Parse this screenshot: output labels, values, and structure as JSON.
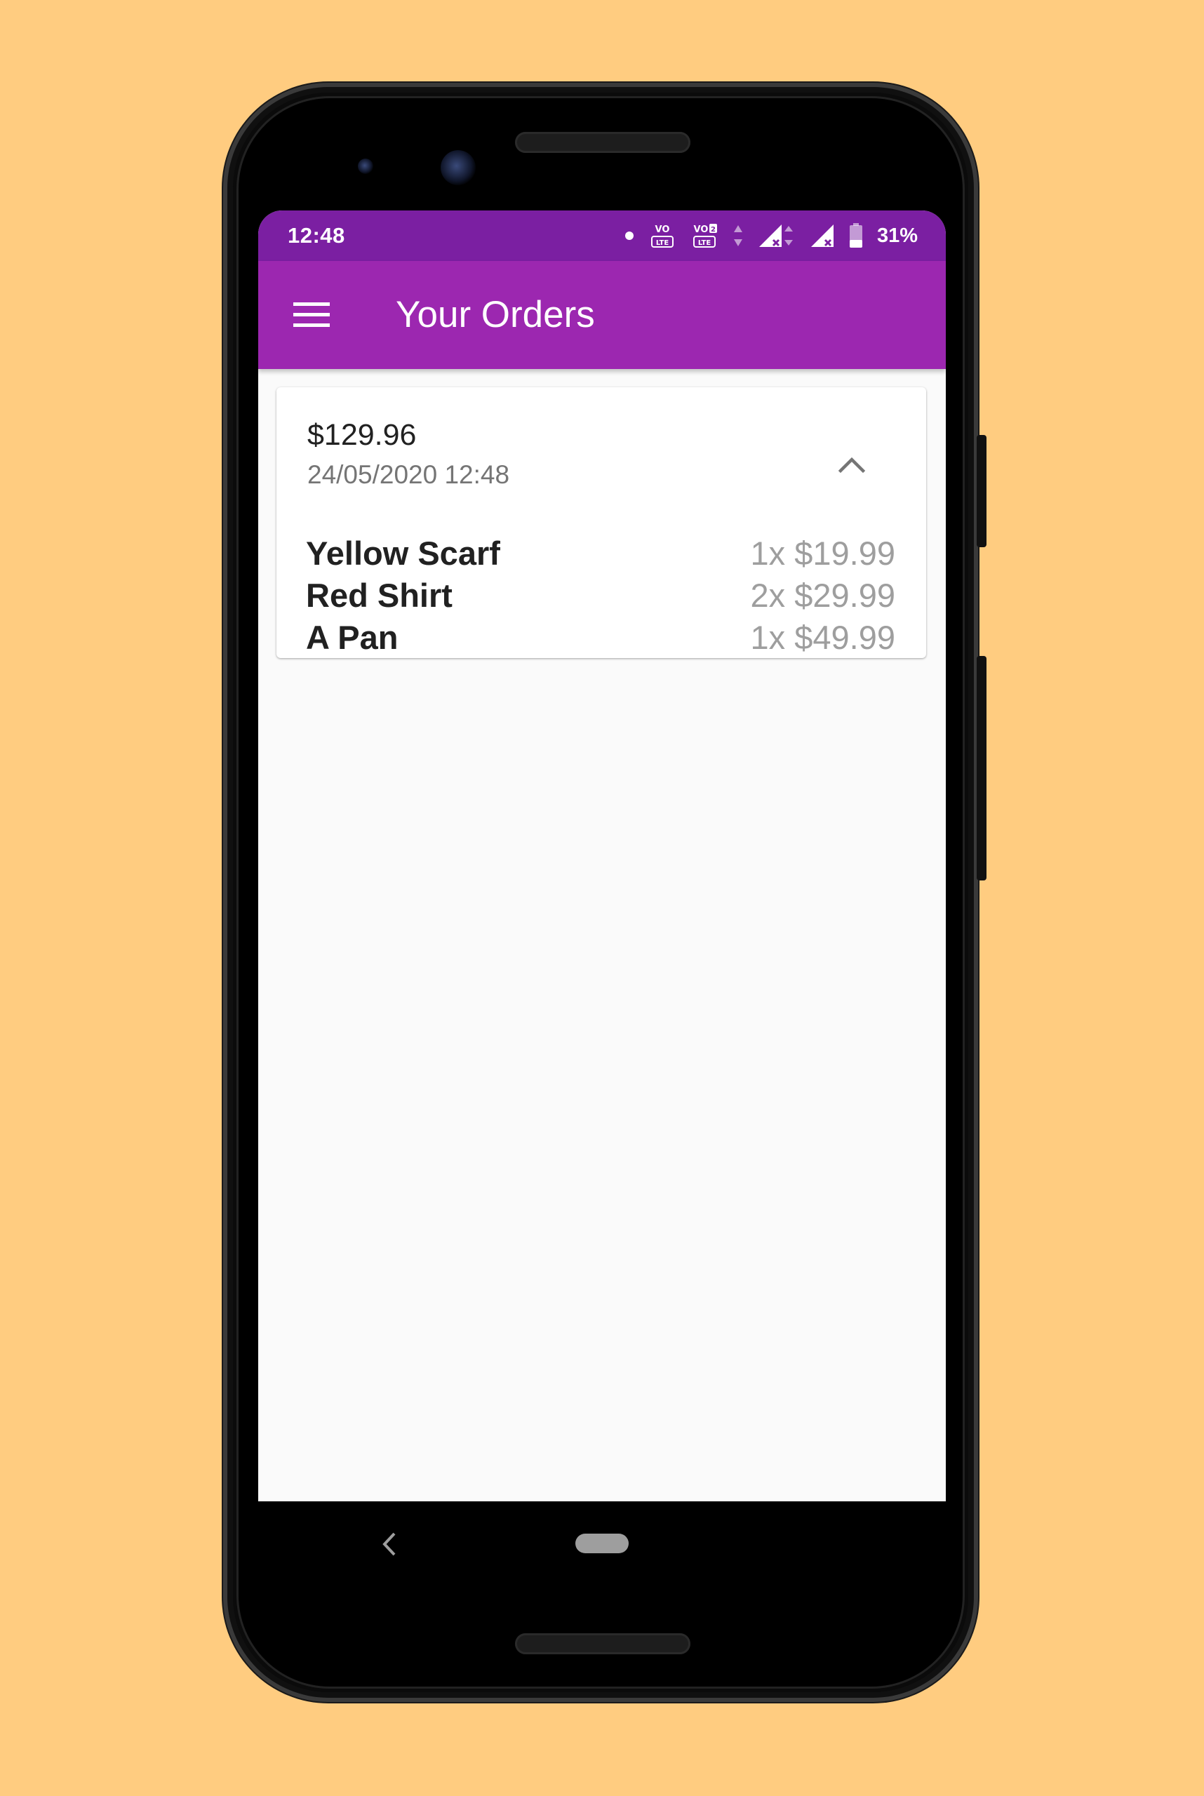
{
  "status_bar": {
    "time": "12:48",
    "battery_percent": "31%",
    "icons": [
      "notification-dot-icon",
      "volte-icon",
      "volte2-icon",
      "data-arrows-icon",
      "signal-icon",
      "signal-icon",
      "battery-icon"
    ]
  },
  "app_bar": {
    "title": "Your Orders",
    "menu_icon": "hamburger-menu-icon"
  },
  "orders": [
    {
      "total": "$129.96",
      "date": "24/05/2020 12:48",
      "expanded": true,
      "toggle_icon": "chevron-up-icon",
      "items": [
        {
          "name": "Yellow Scarf",
          "qty_price": "1x $19.99"
        },
        {
          "name": "Red Shirt",
          "qty_price": "2x $29.99"
        },
        {
          "name": "A Pan",
          "qty_price": "1x $49.99"
        }
      ]
    }
  ],
  "colors": {
    "background": "#FFCC80",
    "status_bar": "#7B1FA2",
    "app_bar": "#9C27B0",
    "screen": "#FAFAFA"
  },
  "nav_bar": {
    "back_icon": "back-icon",
    "home_icon": "home-pill-icon"
  }
}
